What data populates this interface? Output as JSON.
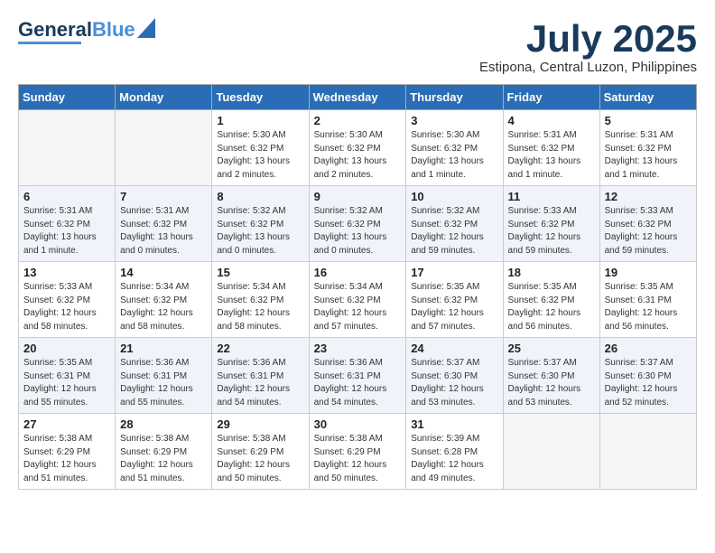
{
  "header": {
    "logo_line1": "General",
    "logo_line2": "Blue",
    "month": "July 2025",
    "location": "Estipona, Central Luzon, Philippines"
  },
  "weekdays": [
    "Sunday",
    "Monday",
    "Tuesday",
    "Wednesday",
    "Thursday",
    "Friday",
    "Saturday"
  ],
  "weeks": [
    [
      {
        "day": "",
        "sunrise": "",
        "sunset": "",
        "daylight": "",
        "empty": true
      },
      {
        "day": "",
        "sunrise": "",
        "sunset": "",
        "daylight": "",
        "empty": true
      },
      {
        "day": "1",
        "sunrise": "Sunrise: 5:30 AM",
        "sunset": "Sunset: 6:32 PM",
        "daylight": "Daylight: 13 hours and 2 minutes."
      },
      {
        "day": "2",
        "sunrise": "Sunrise: 5:30 AM",
        "sunset": "Sunset: 6:32 PM",
        "daylight": "Daylight: 13 hours and 2 minutes."
      },
      {
        "day": "3",
        "sunrise": "Sunrise: 5:30 AM",
        "sunset": "Sunset: 6:32 PM",
        "daylight": "Daylight: 13 hours and 1 minute."
      },
      {
        "day": "4",
        "sunrise": "Sunrise: 5:31 AM",
        "sunset": "Sunset: 6:32 PM",
        "daylight": "Daylight: 13 hours and 1 minute."
      },
      {
        "day": "5",
        "sunrise": "Sunrise: 5:31 AM",
        "sunset": "Sunset: 6:32 PM",
        "daylight": "Daylight: 13 hours and 1 minute."
      }
    ],
    [
      {
        "day": "6",
        "sunrise": "Sunrise: 5:31 AM",
        "sunset": "Sunset: 6:32 PM",
        "daylight": "Daylight: 13 hours and 1 minute."
      },
      {
        "day": "7",
        "sunrise": "Sunrise: 5:31 AM",
        "sunset": "Sunset: 6:32 PM",
        "daylight": "Daylight: 13 hours and 0 minutes."
      },
      {
        "day": "8",
        "sunrise": "Sunrise: 5:32 AM",
        "sunset": "Sunset: 6:32 PM",
        "daylight": "Daylight: 13 hours and 0 minutes."
      },
      {
        "day": "9",
        "sunrise": "Sunrise: 5:32 AM",
        "sunset": "Sunset: 6:32 PM",
        "daylight": "Daylight: 13 hours and 0 minutes."
      },
      {
        "day": "10",
        "sunrise": "Sunrise: 5:32 AM",
        "sunset": "Sunset: 6:32 PM",
        "daylight": "Daylight: 12 hours and 59 minutes."
      },
      {
        "day": "11",
        "sunrise": "Sunrise: 5:33 AM",
        "sunset": "Sunset: 6:32 PM",
        "daylight": "Daylight: 12 hours and 59 minutes."
      },
      {
        "day": "12",
        "sunrise": "Sunrise: 5:33 AM",
        "sunset": "Sunset: 6:32 PM",
        "daylight": "Daylight: 12 hours and 59 minutes."
      }
    ],
    [
      {
        "day": "13",
        "sunrise": "Sunrise: 5:33 AM",
        "sunset": "Sunset: 6:32 PM",
        "daylight": "Daylight: 12 hours and 58 minutes."
      },
      {
        "day": "14",
        "sunrise": "Sunrise: 5:34 AM",
        "sunset": "Sunset: 6:32 PM",
        "daylight": "Daylight: 12 hours and 58 minutes."
      },
      {
        "day": "15",
        "sunrise": "Sunrise: 5:34 AM",
        "sunset": "Sunset: 6:32 PM",
        "daylight": "Daylight: 12 hours and 58 minutes."
      },
      {
        "day": "16",
        "sunrise": "Sunrise: 5:34 AM",
        "sunset": "Sunset: 6:32 PM",
        "daylight": "Daylight: 12 hours and 57 minutes."
      },
      {
        "day": "17",
        "sunrise": "Sunrise: 5:35 AM",
        "sunset": "Sunset: 6:32 PM",
        "daylight": "Daylight: 12 hours and 57 minutes."
      },
      {
        "day": "18",
        "sunrise": "Sunrise: 5:35 AM",
        "sunset": "Sunset: 6:32 PM",
        "daylight": "Daylight: 12 hours and 56 minutes."
      },
      {
        "day": "19",
        "sunrise": "Sunrise: 5:35 AM",
        "sunset": "Sunset: 6:31 PM",
        "daylight": "Daylight: 12 hours and 56 minutes."
      }
    ],
    [
      {
        "day": "20",
        "sunrise": "Sunrise: 5:35 AM",
        "sunset": "Sunset: 6:31 PM",
        "daylight": "Daylight: 12 hours and 55 minutes."
      },
      {
        "day": "21",
        "sunrise": "Sunrise: 5:36 AM",
        "sunset": "Sunset: 6:31 PM",
        "daylight": "Daylight: 12 hours and 55 minutes."
      },
      {
        "day": "22",
        "sunrise": "Sunrise: 5:36 AM",
        "sunset": "Sunset: 6:31 PM",
        "daylight": "Daylight: 12 hours and 54 minutes."
      },
      {
        "day": "23",
        "sunrise": "Sunrise: 5:36 AM",
        "sunset": "Sunset: 6:31 PM",
        "daylight": "Daylight: 12 hours and 54 minutes."
      },
      {
        "day": "24",
        "sunrise": "Sunrise: 5:37 AM",
        "sunset": "Sunset: 6:30 PM",
        "daylight": "Daylight: 12 hours and 53 minutes."
      },
      {
        "day": "25",
        "sunrise": "Sunrise: 5:37 AM",
        "sunset": "Sunset: 6:30 PM",
        "daylight": "Daylight: 12 hours and 53 minutes."
      },
      {
        "day": "26",
        "sunrise": "Sunrise: 5:37 AM",
        "sunset": "Sunset: 6:30 PM",
        "daylight": "Daylight: 12 hours and 52 minutes."
      }
    ],
    [
      {
        "day": "27",
        "sunrise": "Sunrise: 5:38 AM",
        "sunset": "Sunset: 6:29 PM",
        "daylight": "Daylight: 12 hours and 51 minutes."
      },
      {
        "day": "28",
        "sunrise": "Sunrise: 5:38 AM",
        "sunset": "Sunset: 6:29 PM",
        "daylight": "Daylight: 12 hours and 51 minutes."
      },
      {
        "day": "29",
        "sunrise": "Sunrise: 5:38 AM",
        "sunset": "Sunset: 6:29 PM",
        "daylight": "Daylight: 12 hours and 50 minutes."
      },
      {
        "day": "30",
        "sunrise": "Sunrise: 5:38 AM",
        "sunset": "Sunset: 6:29 PM",
        "daylight": "Daylight: 12 hours and 50 minutes."
      },
      {
        "day": "31",
        "sunrise": "Sunrise: 5:39 AM",
        "sunset": "Sunset: 6:28 PM",
        "daylight": "Daylight: 12 hours and 49 minutes."
      },
      {
        "day": "",
        "sunrise": "",
        "sunset": "",
        "daylight": "",
        "empty": true
      },
      {
        "day": "",
        "sunrise": "",
        "sunset": "",
        "daylight": "",
        "empty": true
      }
    ]
  ]
}
